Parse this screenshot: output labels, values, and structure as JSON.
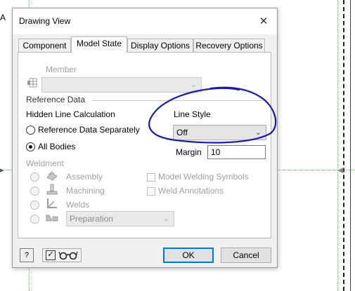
{
  "background": {
    "label_a": "A"
  },
  "dialog": {
    "title": "Drawing View",
    "close": "✕",
    "tabs": [
      {
        "label": "Component"
      },
      {
        "label": "Model State"
      },
      {
        "label": "Display Options"
      },
      {
        "label": "Recovery Options"
      }
    ],
    "member": {
      "label": "Member",
      "value": ""
    },
    "reference_data": {
      "heading": "Reference Data",
      "hidden_line_label": "Hidden Line Calculation",
      "options": [
        {
          "label": "Reference Data Separately",
          "selected": false
        },
        {
          "label": "All Bodies",
          "selected": true
        }
      ],
      "line_style": {
        "label": "Line Style",
        "value": "Off"
      },
      "margin": {
        "label": "Margin",
        "value": "10"
      }
    },
    "weldment": {
      "heading": "Weldment",
      "options": [
        {
          "label": "Assembly",
          "icon": "assembly-icon"
        },
        {
          "label": "Machining",
          "icon": "machining-icon"
        },
        {
          "label": "Welds",
          "icon": "welds-icon"
        }
      ],
      "preparation": {
        "value": "Preparation",
        "icon": "preparation-icon"
      },
      "checkboxes": [
        {
          "label": "Model Welding Symbols",
          "checked": false
        },
        {
          "label": "Weld Annotations",
          "checked": false
        }
      ]
    },
    "footer": {
      "help": "?",
      "ok": "OK",
      "cancel": "Cancel"
    }
  },
  "colors": {
    "accent": "#0078d7",
    "annotation": "#1a1aa8"
  }
}
